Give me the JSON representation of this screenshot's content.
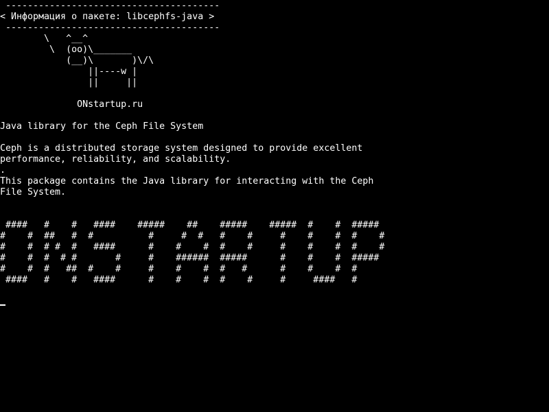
{
  "terminal": {
    "fg_color": "#ffffff",
    "bg_color": "#000000",
    "lines": [
      " ---------------------------------------",
      "< Информация о пакете: libcephfs-java >",
      " ---------------------------------------",
      "        \\   ^__^",
      "         \\  (oo)\\_______",
      "            (__)\\       )\\/\\",
      "                ||----w |",
      "                ||     ||",
      "",
      "              ONstartup.ru",
      "",
      "Java library for the Ceph File System",
      "",
      "Ceph is a distributed storage system designed to provide excellent",
      "performance, reliability, and scalability.",
      ".",
      "This package contains the Java library for interacting with the Ceph",
      "File System.",
      "",
      "",
      " ####   #    #   ####    #####    ##    #####    #####  #    #  #####",
      "#    #  ##   #  #          #     #  #   #    #     #    #    #  #    #",
      "#    #  # #  #   ####      #    #    #  #    #     #    #    #  #    #",
      "#    #  #  # #       #     #    ######  #####      #    #    #  #####",
      "#    #  #   ##  #    #     #    #    #  #   #      #    #    #  #",
      " ####   #    #   ####      #    #    #  #    #     #     ####   #"
    ]
  }
}
